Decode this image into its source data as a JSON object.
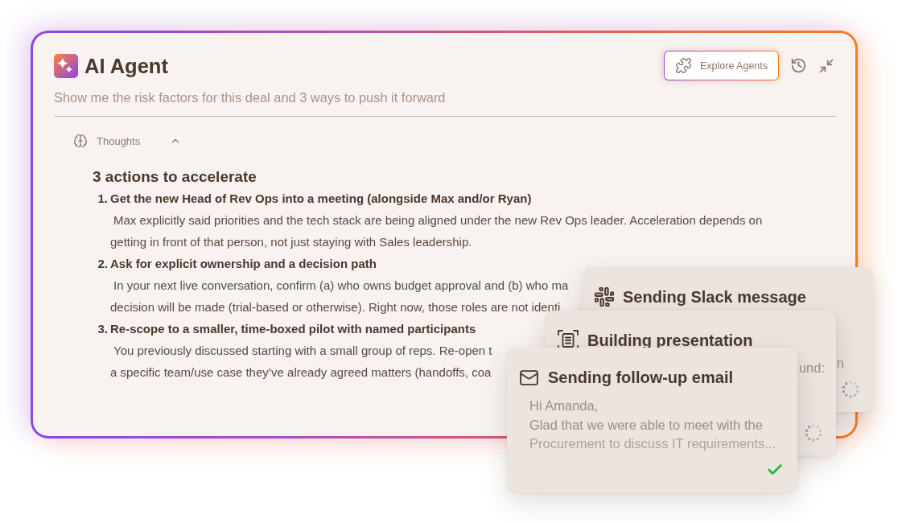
{
  "header": {
    "title": "AI Agent",
    "explore_button": {
      "label": "Explore Agents"
    }
  },
  "prompt": "Show me the risk factors for this deal and 3 ways to push it forward",
  "thoughts": {
    "label": "Thoughts",
    "expanded": true
  },
  "response": {
    "heading": "3 actions to accelerate",
    "items": [
      {
        "number": "1.",
        "title": "Get the new Head of Rev Ops into a meeting (alongside Max and/or Ryan)",
        "lines": [
          "Max explicitly said priorities and the tech stack are being aligned under the new Rev Ops leader. Acceleration depends on",
          "getting in front of that person, not just staying with Sales leadership."
        ]
      },
      {
        "number": "2.",
        "title": "Ask for explicit ownership and a decision path",
        "lines": [
          "In your next live conversation, confirm (a) who owns budget approval and (b) who ma",
          "decision will be made (trial-based or otherwise). Right now, those roles are not identi"
        ]
      },
      {
        "number": "3.",
        "title": "Re-scope to a smaller, time-boxed pilot with named participants",
        "lines": [
          "You previously discussed starting with a small group of reps. Re-open t",
          "a specific team/use case they’ve already agreed matters (handoffs, coa"
        ]
      }
    ]
  },
  "tasks": [
    {
      "kind": "slack",
      "title": "Sending Slack message",
      "body": [
        "n"
      ],
      "completed": false
    },
    {
      "kind": "presentation",
      "title": "Building presentation",
      "body": [
        "und:"
      ],
      "completed": false
    },
    {
      "kind": "email",
      "title": "Sending follow-up email",
      "body": [
        "Hi Amanda,",
        "Glad that we were able to meet with the",
        "Procurement to discuss IT requirements..."
      ],
      "completed": true
    }
  ]
}
